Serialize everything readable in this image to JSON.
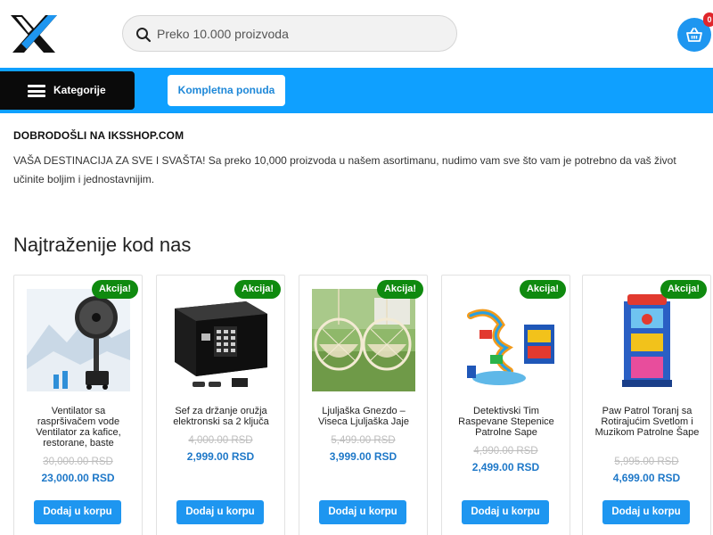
{
  "header": {
    "search_placeholder": "Preko 10.000 proizvoda",
    "cart_count": "0"
  },
  "nav": {
    "categories_label": "Kategorije",
    "offer_label": "Kompletna ponuda"
  },
  "welcome": {
    "title": "DOBRODOŠLI NA IKSSHOP.COM",
    "text": "VAŠA DESTINACIJA ZA SVE I SVAŠTA! Sa preko 10,000 proizvoda u našem asortimanu, nudimo vam sve što vam je potrebno da vaš život učinite boljim i jednostavnijim."
  },
  "section": {
    "title": "Najtraženije kod nas"
  },
  "products": [
    {
      "badge": "Akcija!",
      "name": "Ventilator sa raspršivačem vode Ventilator za kafice, restorane, baste",
      "old_price": "30,000.00 RSD",
      "new_price": "23,000.00 RSD",
      "button": "Dodaj u korpu"
    },
    {
      "badge": "Akcija!",
      "name": "Sef za držanje oružja elektronski sa 2 ključa",
      "old_price": "4,000.00 RSD",
      "new_price": "2,999.00 RSD",
      "button": "Dodaj u korpu"
    },
    {
      "badge": "Akcija!",
      "name": "Ljuljaška Gnezdo – Viseca Ljuljaška Jaje",
      "old_price": "5,499.00 RSD",
      "new_price": "3,999.00 RSD",
      "button": "Dodaj u korpu"
    },
    {
      "badge": "Akcija!",
      "name": "Detektivski Tim Raspevane Stepenice Patrolne Sape",
      "old_price": "4,990.00 RSD",
      "new_price": "2,499.00 RSD",
      "button": "Dodaj u korpu"
    },
    {
      "badge": "Akcija!",
      "name": "Paw Patrol Toranj sa Rotirajućim Svetlom i Muzikom Patrolne Šape",
      "old_price": "5,995.00 RSD",
      "new_price": "4,699.00 RSD",
      "button": "Dodaj u korpu"
    }
  ],
  "colors": {
    "brand_blue": "#0fa0ff",
    "button_blue": "#1e96f0",
    "sale_green": "#0f8a0f",
    "price_blue": "#1e78c8"
  }
}
